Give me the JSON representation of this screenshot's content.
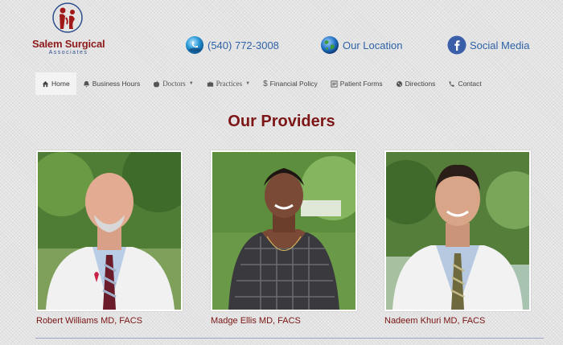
{
  "logo": {
    "name": "Salem Surgical",
    "subtitle": "Associates"
  },
  "contacts": {
    "phone": "(540) 772-3008",
    "location": "Our Location",
    "social": "Social Media"
  },
  "nav": [
    {
      "label": "Home",
      "icon": "home-icon",
      "active": true
    },
    {
      "label": "Business Hours",
      "icon": "bell-icon"
    },
    {
      "label": "Doctors",
      "icon": "apple-icon",
      "dropdown": true
    },
    {
      "label": "Practices",
      "icon": "briefcase-icon",
      "dropdown": true
    },
    {
      "label": "Financial Policy",
      "icon": "dollar-icon"
    },
    {
      "label": "Patient Forms",
      "icon": "forms-icon"
    },
    {
      "label": "Directions",
      "icon": "globe-icon"
    },
    {
      "label": "Contact",
      "icon": "phone-icon"
    }
  ],
  "page_title": "Our Providers",
  "providers": [
    {
      "name": "Robert Williams MD, FACS"
    },
    {
      "name": "Madge Ellis MD, FACS"
    },
    {
      "name": "Nadeem Khuri MD, FACS"
    }
  ],
  "colors": {
    "brand": "#7d1616",
    "link": "#2f62a8"
  }
}
